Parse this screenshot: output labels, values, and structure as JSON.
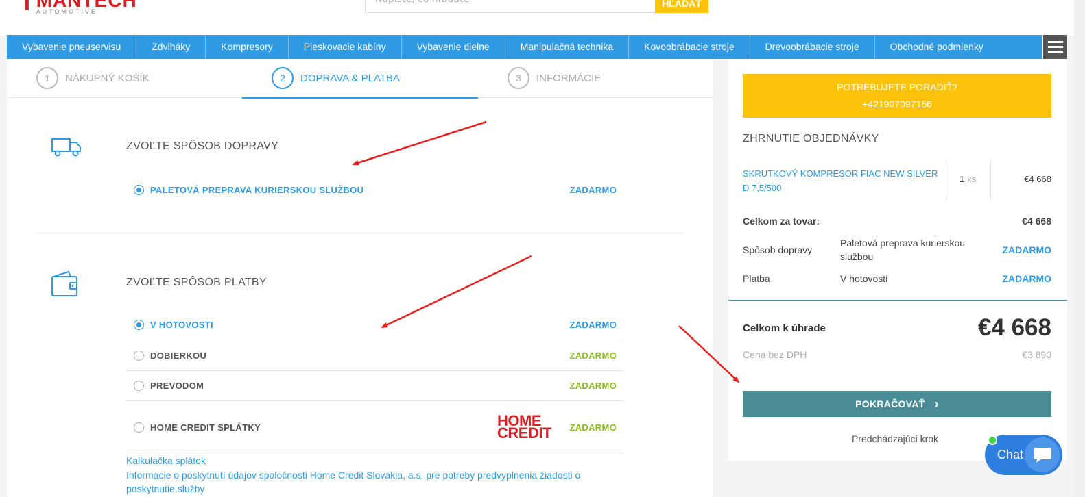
{
  "header": {
    "logo_name": "MANTECH",
    "logo_sub": "AUTOMOTIVE",
    "search_placeholder": "Napíšte, čo hľadáte",
    "search_button": "HĽADAŤ"
  },
  "nav": {
    "items": [
      "Vybavenie pneuservisu",
      "Zdviháky",
      "Kompresory",
      "Pieskovacie kabíny",
      "Vybavenie dielne",
      "Manipulačná technika",
      "Kovoobrábacie stroje",
      "Drevoobrábacie stroje",
      "Obchodné podmienky"
    ]
  },
  "steps": [
    {
      "num": "1",
      "label": "NÁKUPNÝ KOŠÍK"
    },
    {
      "num": "2",
      "label": "DOPRAVA & PLATBA"
    },
    {
      "num": "3",
      "label": "INFORMÁCIE"
    }
  ],
  "shipping": {
    "title": "ZVOĽTE SPÔSOB DOPRAVY",
    "options": [
      {
        "label": "PALETOVÁ PREPRAVA KURIERSKOU SLUŽBOU",
        "price": "ZADARMO",
        "selected": true
      }
    ]
  },
  "payment": {
    "title": "ZVOĽTE SPÔSOB PLATBY",
    "options": [
      {
        "label": "V HOTOVOSTI",
        "price": "ZADARMO",
        "selected": true
      },
      {
        "label": "DOBIERKOU",
        "price": "ZADARMO",
        "selected": false
      },
      {
        "label": "PREVODOM",
        "price": "ZADARMO",
        "selected": false
      },
      {
        "label": "HOME CREDIT SPLÁTKY",
        "price": "ZADARMO",
        "selected": false
      }
    ],
    "home_credit_logo_line1": "HOME",
    "home_credit_logo_line2": "CREDIT",
    "calc_link": "Kalkulačka splátok",
    "info_link": "Informácie o poskytnutí údajov spoločnosti Home Credit Slovakia, a.s. pre potreby predvyplnenia žiadosti o poskytnutie služby"
  },
  "sidebar": {
    "advice_line1": "POTREBUJETE PORADIŤ?",
    "advice_line2": "+421907097156",
    "summary_title": "ZHRNUTIE OBJEDNÁVKY",
    "product": {
      "name": "SKRUTKOVÝ KOMPRESOR FIAC NEW SILVER D 7,5/500",
      "qty": "1",
      "qty_unit": "ks",
      "price": "€4 668"
    },
    "goods_total_label": "Celkom za tovar:",
    "goods_total_value": "€4 668",
    "shipping_label": "Spôsob dopravy",
    "shipping_value": "Paletová preprava kurierskou službou",
    "shipping_price": "ZADARMO",
    "payment_label": "Platba",
    "payment_value": "V hotovosti",
    "payment_price": "ZADARMO",
    "total_label": "Celkom k úhrade",
    "total_value": "€4 668",
    "no_vat_label": "Cena bez DPH",
    "no_vat_value": "€3 890",
    "continue_button": "POKRAČOVAŤ",
    "prev_step": "Predchádzajúci krok"
  },
  "chat": {
    "label": "Chat"
  },
  "colors": {
    "nav_blue": "#2f9ae4",
    "accent_yellow": "#fdc20a",
    "teal": "#4a8c96",
    "brand_red": "#d81f26",
    "price_green": "#8cbc1f",
    "arrow_red": "#e8201f"
  }
}
